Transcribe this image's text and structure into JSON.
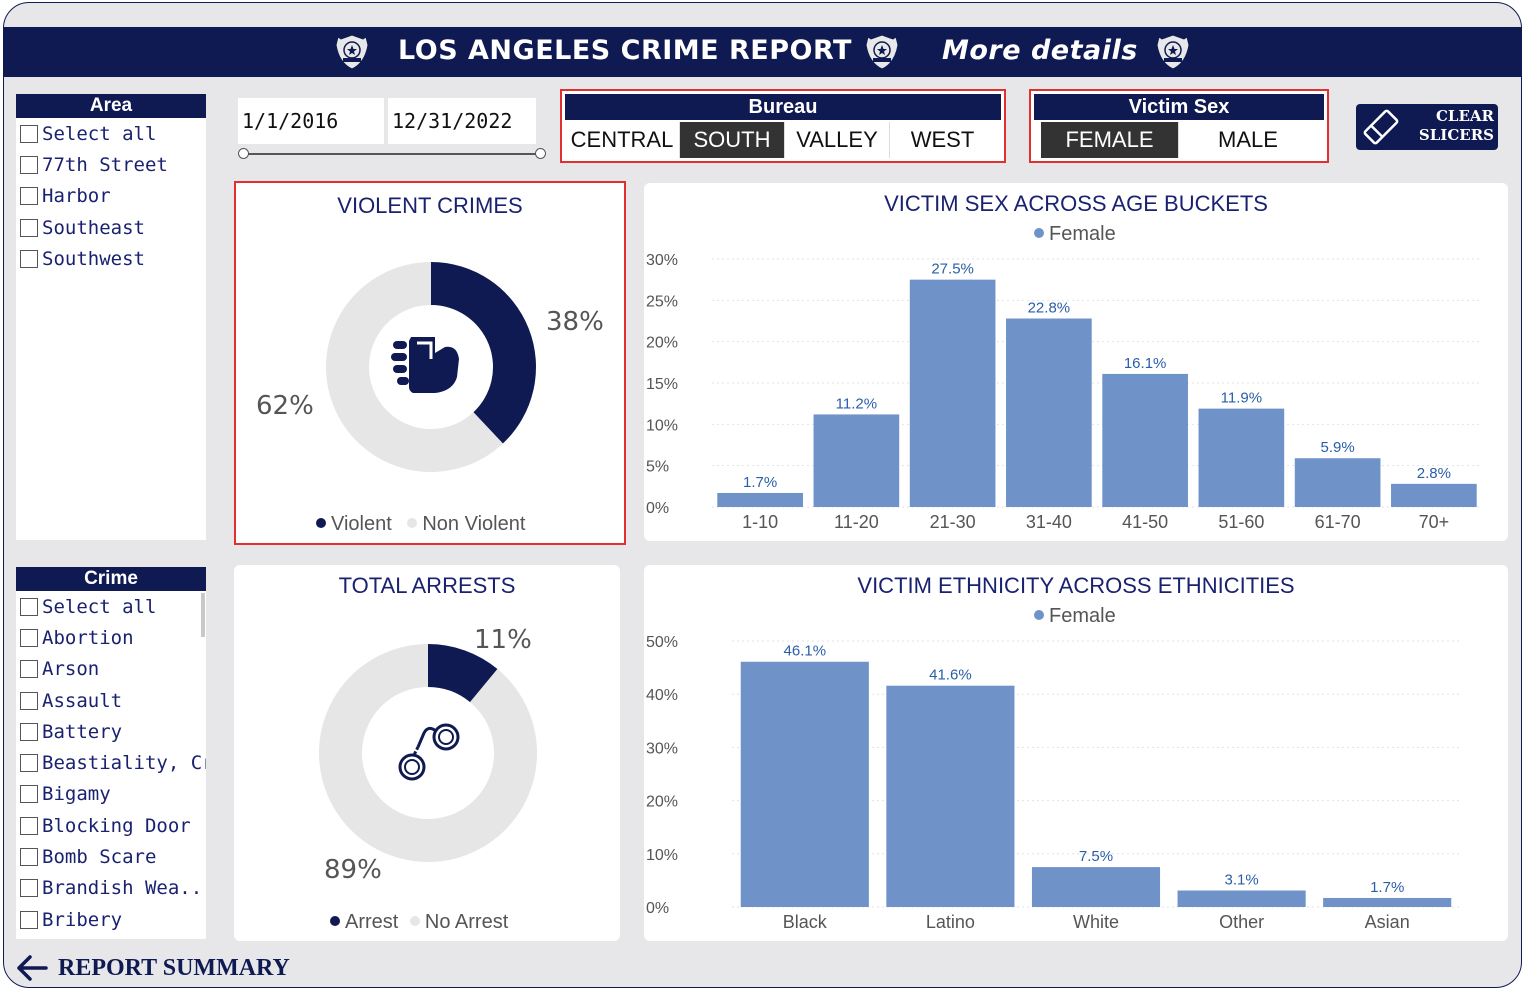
{
  "header": {
    "title": "LOS ANGELES CRIME REPORT",
    "more_details": "More details",
    "badge_icon": "police-badge-icon"
  },
  "area_slicer": {
    "title": "Area",
    "items": [
      "Select all",
      "77th Street",
      "Harbor",
      "Southeast",
      "Southwest"
    ]
  },
  "crime_slicer": {
    "title": "Crime",
    "items": [
      "Select all",
      "Abortion",
      "Arson",
      "Assault",
      "Battery",
      "Beastiality, Cri...",
      "Bigamy",
      "Blocking Door ...",
      "Bomb Scare",
      "Brandish Wea...",
      "Bribery"
    ]
  },
  "date_range": {
    "start": "1/1/2016",
    "end": "12/31/2022"
  },
  "bureau_slicer": {
    "title": "Bureau",
    "options": [
      "CENTRAL",
      "SOUTH",
      "VALLEY",
      "WEST"
    ],
    "selected": "SOUTH"
  },
  "victim_sex_slicer": {
    "title": "Victim Sex",
    "options": [
      "FEMALE",
      "MALE"
    ],
    "selected": "FEMALE"
  },
  "clear_button": {
    "line1": "CLEAR",
    "line2": "SLICERS"
  },
  "violent_card": {
    "title": "VIOLENT CRIMES",
    "icon": "fist-icon",
    "slices": [
      {
        "label": "Violent",
        "value": 38,
        "text": "38%",
        "color": "#0f1a52"
      },
      {
        "label": "Non Violent",
        "value": 62,
        "text": "62%",
        "color": "#e6e6e6"
      }
    ]
  },
  "arrests_card": {
    "title": "TOTAL ARRESTS",
    "icon": "handcuffs-icon",
    "slices": [
      {
        "label": "Arrest",
        "value": 11,
        "text": "11%",
        "color": "#0f1a52"
      },
      {
        "label": "No Arrest",
        "value": 89,
        "text": "89%",
        "color": "#e6e6e6"
      }
    ]
  },
  "chart_data": [
    {
      "type": "bar",
      "title": "VICTIM SEX ACROSS AGE BUCKETS",
      "series": [
        {
          "name": "Female",
          "values": [
            1.7,
            11.2,
            27.5,
            22.8,
            16.1,
            11.9,
            5.9,
            2.8
          ]
        }
      ],
      "categories": [
        "1-10",
        "11-20",
        "21-30",
        "31-40",
        "41-50",
        "51-60",
        "61-70",
        "70+"
      ],
      "data_labels": [
        "1.7%",
        "11.2%",
        "27.5%",
        "22.8%",
        "16.1%",
        "11.9%",
        "5.9%",
        "2.8%"
      ],
      "ylim": [
        0,
        30
      ],
      "yticks": [
        "0%",
        "5%",
        "10%",
        "15%",
        "20%",
        "25%",
        "30%"
      ],
      "grid": true,
      "legend": "top-center",
      "color": "#6f93c8"
    },
    {
      "type": "bar",
      "title": "VICTIM ETHNICITY ACROSS ETHNICITIES",
      "series": [
        {
          "name": "Female",
          "values": [
            46.1,
            41.6,
            7.5,
            3.1,
            1.7
          ]
        }
      ],
      "categories": [
        "Black",
        "Latino",
        "White",
        "Other",
        "Asian"
      ],
      "data_labels": [
        "46.1%",
        "41.6%",
        "7.5%",
        "3.1%",
        "1.7%"
      ],
      "ylim": [
        0,
        50
      ],
      "yticks": [
        "0%",
        "10%",
        "20%",
        "30%",
        "40%",
        "50%"
      ],
      "grid": true,
      "legend": "top-center",
      "color": "#6f93c8"
    }
  ],
  "footer": {
    "label": "REPORT SUMMARY",
    "icon": "back-arrow-icon"
  }
}
